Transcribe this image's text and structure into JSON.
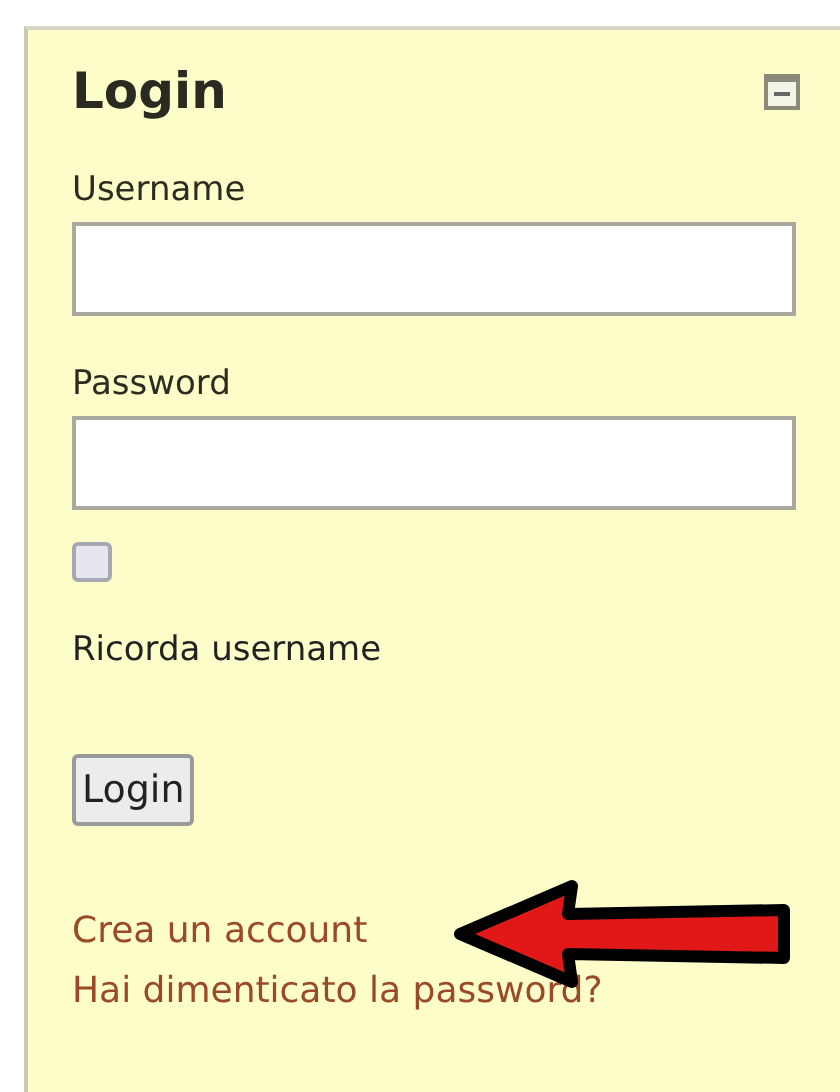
{
  "panel": {
    "title": "Login",
    "collapsible": true
  },
  "fields": [
    {
      "label": "Username"
    },
    {
      "label": "Password"
    }
  ],
  "remember": {
    "label": "Ricorda username",
    "checked": false
  },
  "submit": {
    "label": "Login"
  },
  "links": [
    {
      "label": "Crea un account",
      "highlighted": true
    },
    {
      "label": "Hai dimenticato la password?",
      "highlighted": false
    }
  ]
}
